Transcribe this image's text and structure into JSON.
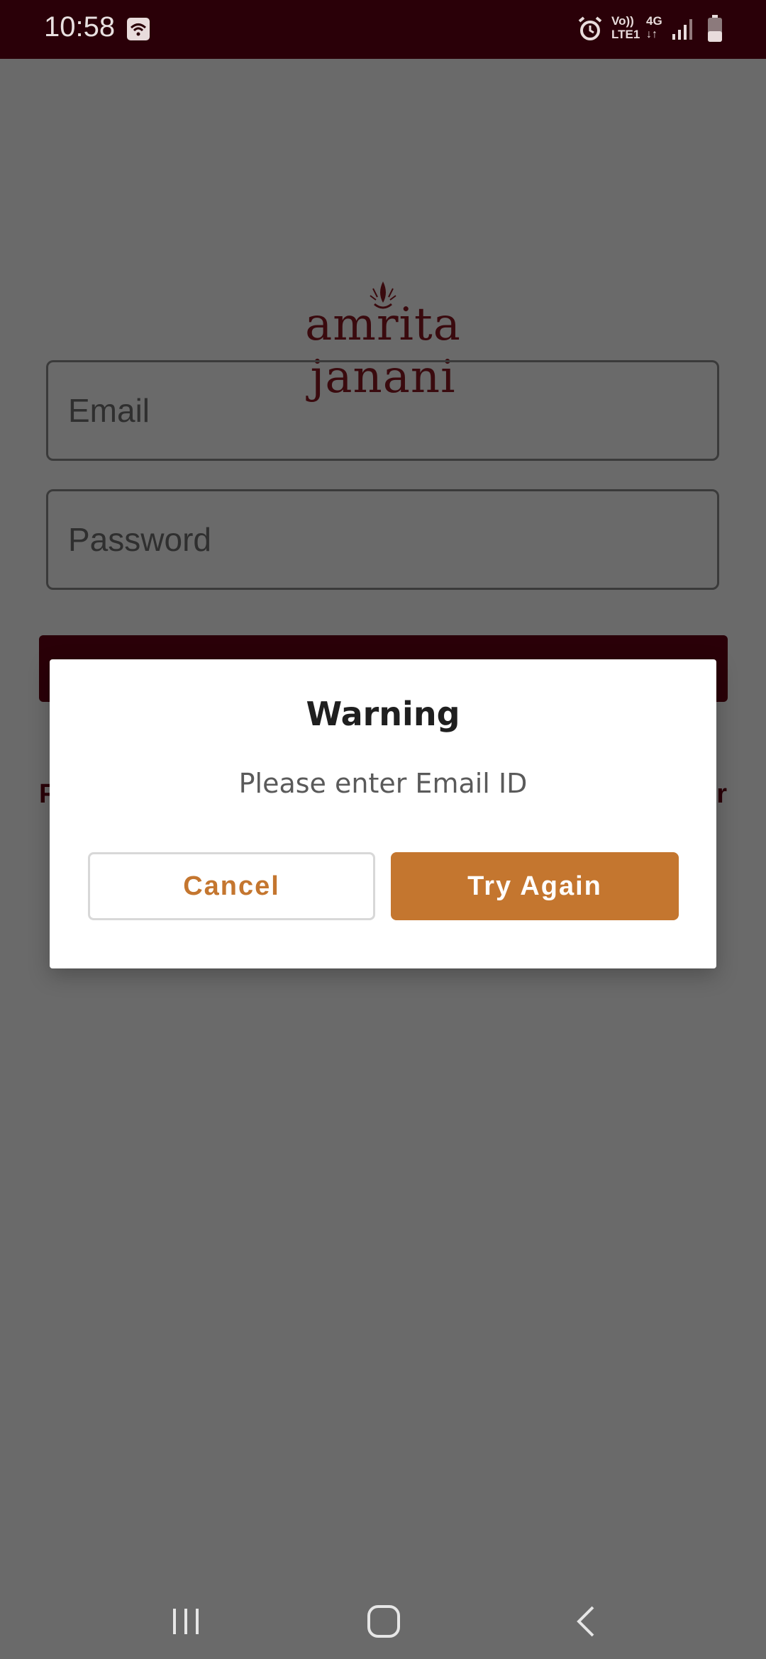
{
  "status_bar": {
    "time": "10:58",
    "icons": [
      "wifi-icon",
      "alarm-icon",
      "volte-lte1-icon",
      "4g-data-icon",
      "signal-icon",
      "battery-icon"
    ],
    "volte_text": "Vo))",
    "lte_text": "LTE1",
    "network_text": "4G"
  },
  "logo": {
    "text": "amrita janani"
  },
  "form": {
    "email_placeholder": "Email",
    "password_placeholder": "Password",
    "forgot_link_partial": "F",
    "register_link_partial": "r"
  },
  "dialog": {
    "title": "Warning",
    "message": "Please enter Email ID",
    "cancel_label": "Cancel",
    "try_again_label": "Try Again"
  },
  "colors": {
    "status_bar": "#2a0008",
    "accent": "#c4762f",
    "scrim": "#6a6a6a"
  },
  "nav_bar": {
    "icons": [
      "recent-apps-icon",
      "home-icon",
      "back-icon"
    ]
  }
}
